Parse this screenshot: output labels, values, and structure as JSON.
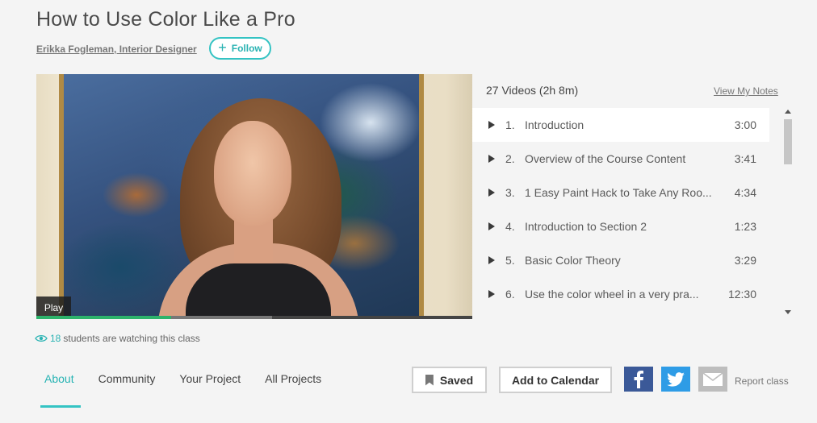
{
  "course": {
    "title": "How to Use Color Like a Pro",
    "author": "Erikka Fogleman, Interior Designer",
    "follow_label": "Follow"
  },
  "video": {
    "play_label": "Play",
    "played_percent": 31,
    "buffered_percent": 54
  },
  "playlist": {
    "summary": "27 Videos (2h 8m)",
    "view_notes": "View My Notes",
    "items": [
      {
        "num": "1.",
        "title": "Introduction",
        "duration": "3:00"
      },
      {
        "num": "2.",
        "title": "Overview of the Course Content",
        "duration": "3:41"
      },
      {
        "num": "3.",
        "title": "1 Easy Paint Hack to Take Any Roo...",
        "duration": "4:34"
      },
      {
        "num": "4.",
        "title": "Introduction to Section 2",
        "duration": "1:23"
      },
      {
        "num": "5.",
        "title": "Basic Color Theory",
        "duration": "3:29"
      },
      {
        "num": "6.",
        "title": "Use the color wheel in a very pra...",
        "duration": "12:30"
      }
    ]
  },
  "watching": {
    "count": "18",
    "text": "students are watching this class"
  },
  "tabs": [
    {
      "label": "About"
    },
    {
      "label": "Community"
    },
    {
      "label": "Your Project"
    },
    {
      "label": "All Projects"
    }
  ],
  "actions": {
    "saved": "Saved",
    "add_to_calendar": "Add to Calendar",
    "report": "Report class"
  },
  "icons": {
    "follow": "plus-icon",
    "playlist_item": "play-triangle-icon",
    "watching": "eye-icon",
    "saved": "bookmark-icon",
    "share": [
      "facebook-icon",
      "twitter-icon",
      "mail-icon"
    ]
  },
  "colors": {
    "accent": "#2ab3b3",
    "progress": "#2db36b",
    "facebook": "#3b5998",
    "twitter": "#2e9ce6",
    "mail": "#bdbdbd"
  }
}
